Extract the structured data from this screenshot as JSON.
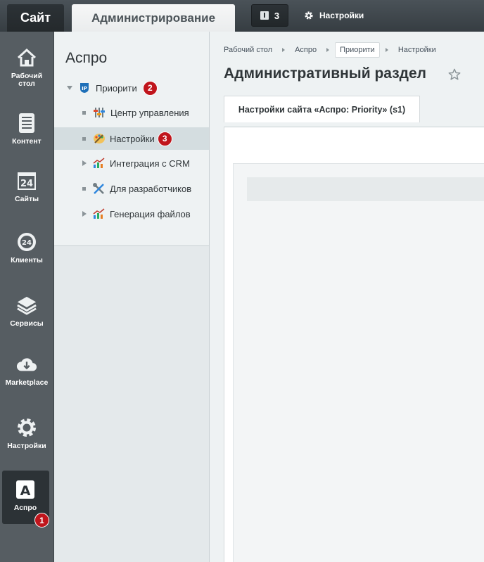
{
  "topbar": {
    "tab_site": "Сайт",
    "tab_admin": "Администрирование",
    "notifications_count": "3",
    "settings_label": "Настройки"
  },
  "leftmenu": {
    "items": [
      {
        "label": "Рабочий стол",
        "icon": "home-icon"
      },
      {
        "label": "Контент",
        "icon": "document-icon"
      },
      {
        "label": "Сайты",
        "icon": "calendar-24-icon"
      },
      {
        "label": "Клиенты",
        "icon": "clients-24-icon"
      },
      {
        "label": "Сервисы",
        "icon": "layers-icon"
      },
      {
        "label": "Marketplace",
        "icon": "cloud-download-icon"
      },
      {
        "label": "Настройки",
        "icon": "gear-icon"
      },
      {
        "label": "Аспро",
        "icon": "aspro-a-icon"
      }
    ],
    "badge": "1"
  },
  "submenu": {
    "title": "Аспро",
    "root": {
      "label": "Приорити",
      "badge": "2"
    },
    "items": [
      {
        "label": "Центр управления",
        "icon": "sliders-icon"
      },
      {
        "label": "Настройки",
        "icon": "palette-icon",
        "badge": "3"
      },
      {
        "label": "Интеграция с CRM",
        "icon": "chart-icon"
      },
      {
        "label": "Для разработчиков",
        "icon": "tools-icon"
      },
      {
        "label": "Генерация файлов",
        "icon": "chart-icon"
      }
    ]
  },
  "main": {
    "breadcrumbs": [
      "Рабочий стол",
      "Аспро",
      "Приорити",
      "Настройки"
    ],
    "title": "Административный раздел",
    "tab_label": "Настройки сайта «Аспро: Priority» (s1)"
  }
}
